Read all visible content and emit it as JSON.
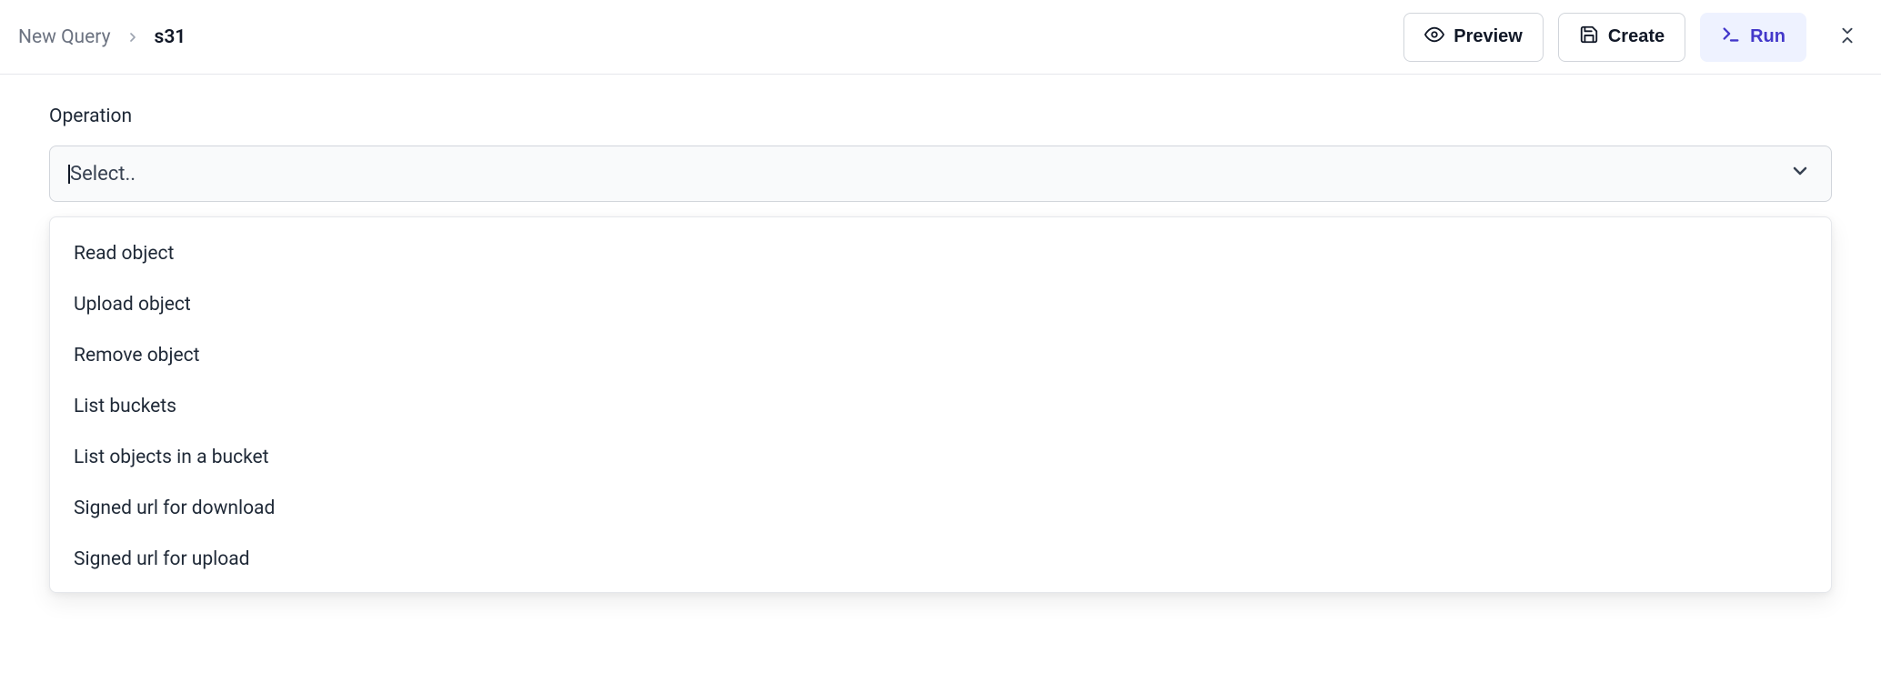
{
  "breadcrumb": {
    "root": "New Query",
    "current": "s31"
  },
  "actions": {
    "preview": "Preview",
    "create": "Create",
    "run": "Run"
  },
  "form": {
    "operation_label": "Operation",
    "select_placeholder": "Select.."
  },
  "dropdown": {
    "options": [
      "Read object",
      "Upload object",
      "Remove object",
      "List buckets",
      "List objects in a bucket",
      "Signed url for download",
      "Signed url for upload"
    ]
  }
}
